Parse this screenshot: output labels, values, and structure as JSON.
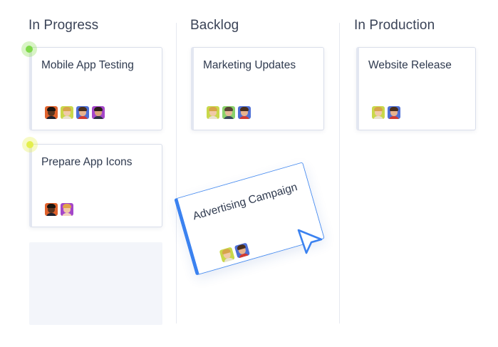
{
  "columns": [
    {
      "title": "In Progress"
    },
    {
      "title": "Backlog"
    },
    {
      "title": "In Production"
    }
  ],
  "cards": {
    "mobile_app_testing": "Mobile App Testing",
    "prepare_app_icons": "Prepare App Icons",
    "marketing_updates": "Marketing Updates",
    "website_release": "Website Release",
    "advertising_campaign": "Advertising Campaign"
  },
  "status_colors": {
    "active": "#8ee05a",
    "pending": "#e8f25a"
  },
  "accent": "#3b82f0",
  "icons": {
    "cursor": "mouse-pointer-icon",
    "avatar": "user-avatar-icon"
  }
}
